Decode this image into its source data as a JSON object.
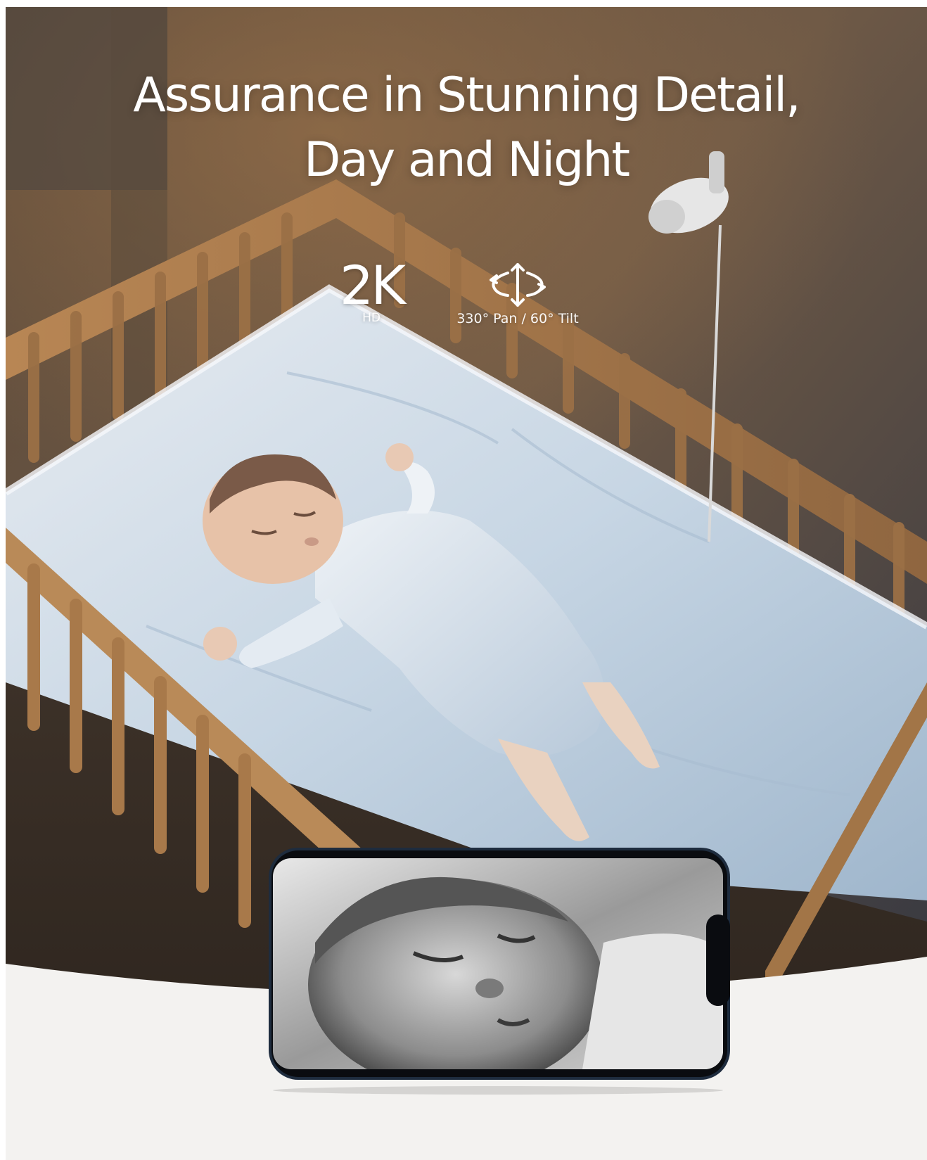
{
  "headline": {
    "line1": "Assurance in Stunning Detail,",
    "line2": "Day and Night"
  },
  "features": [
    {
      "value": "2K",
      "label": "HD"
    },
    {
      "icon": "pan-tilt-rotate-icon",
      "label": "330° Pan / 60° Tilt"
    }
  ],
  "colors": {
    "text": "#ffffff",
    "background_bottom": "#f3f2f0",
    "phone_frame": "#1e2c3e"
  }
}
